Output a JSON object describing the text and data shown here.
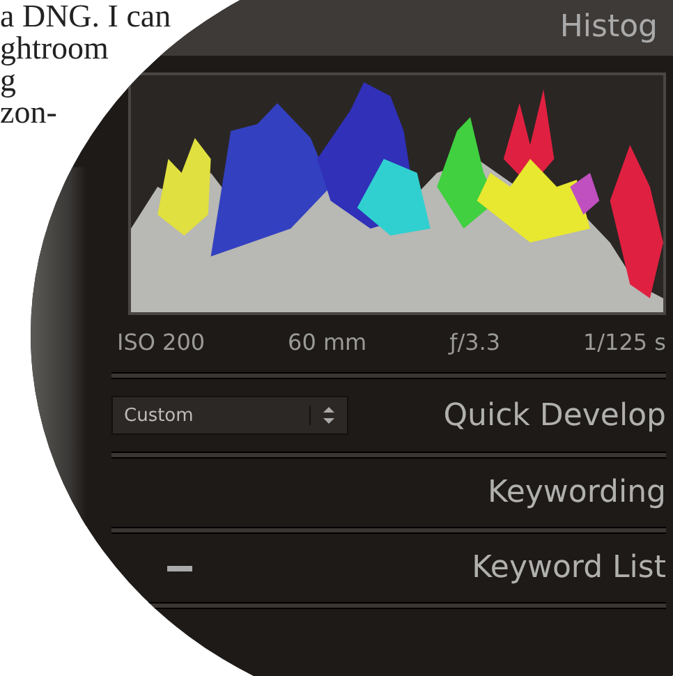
{
  "print_text": [
    "a DNG. I can",
    "ghtroom",
    "g",
    "zon-"
  ],
  "histogram": {
    "title": "Histog",
    "info": [
      "ISO 200",
      "60 mm",
      "ƒ/3.3",
      "1/125 s"
    ]
  },
  "quick_develop": {
    "preset": "Custom",
    "title": "Quick Develop"
  },
  "panels": [
    {
      "title": "Keywording",
      "kind": "plain"
    },
    {
      "title": "Keyword List",
      "kind": "minus"
    }
  ]
}
